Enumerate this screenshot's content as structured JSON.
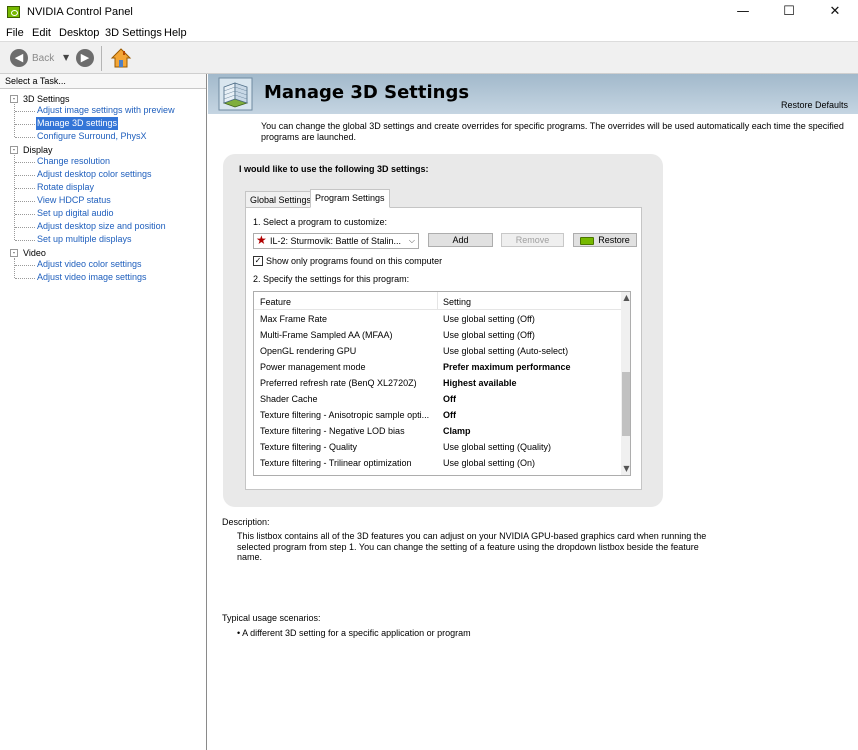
{
  "window": {
    "title": "NVIDIA Control Panel",
    "minimize_glyph": "—",
    "maximize_glyph": "☐",
    "close_glyph": "✕"
  },
  "menu": [
    "File",
    "Edit",
    "Desktop",
    "3D Settings",
    "Help"
  ],
  "toolbar": {
    "back_label": "Back",
    "back_icon": "arrow-left-icon",
    "forward_icon": "arrow-right-icon",
    "home_icon": "home-icon"
  },
  "sidebar": {
    "header": "Select a Task...",
    "groups": [
      {
        "label": "3D Settings",
        "items": [
          {
            "label": "Adjust image settings with preview",
            "selected": false
          },
          {
            "label": "Manage 3D settings",
            "selected": true
          },
          {
            "label": "Configure Surround, PhysX",
            "selected": false
          }
        ]
      },
      {
        "label": "Display",
        "items": [
          {
            "label": "Change resolution",
            "selected": false
          },
          {
            "label": "Adjust desktop color settings",
            "selected": false
          },
          {
            "label": "Rotate display",
            "selected": false
          },
          {
            "label": "View HDCP status",
            "selected": false
          },
          {
            "label": "Set up digital audio",
            "selected": false
          },
          {
            "label": "Adjust desktop size and position",
            "selected": false
          },
          {
            "label": "Set up multiple displays",
            "selected": false
          }
        ]
      },
      {
        "label": "Video",
        "items": [
          {
            "label": "Adjust video color settings",
            "selected": false
          },
          {
            "label": "Adjust video image settings",
            "selected": false
          }
        ]
      }
    ]
  },
  "page": {
    "title": "Manage 3D Settings",
    "restore_defaults": "Restore Defaults",
    "intro": "You can change the global 3D settings and create overrides for specific programs. The overrides will be used automatically each time the specified programs are launched.",
    "panel_heading": "I would like to use the following 3D settings:",
    "tabs": [
      {
        "label": "Global Settings",
        "active": false
      },
      {
        "label": "Program Settings",
        "active": true
      }
    ],
    "step1_label": "1. Select a program to customize:",
    "program_selected": "IL-2: Sturmovik: Battle of Stalin...",
    "buttons": {
      "add": "Add",
      "remove": "Remove",
      "restore": "Restore"
    },
    "show_only_checkbox": {
      "label": "Show only programs found on this computer",
      "checked": true
    },
    "step2_label": "2. Specify the settings for this program:",
    "columns": {
      "feature": "Feature",
      "setting": "Setting"
    },
    "rows": [
      {
        "feature": "Max Frame Rate",
        "setting": "Use global setting (Off)",
        "bold": false
      },
      {
        "feature": "Multi-Frame Sampled AA (MFAA)",
        "setting": "Use global setting (Off)",
        "bold": false
      },
      {
        "feature": "OpenGL rendering GPU",
        "setting": "Use global setting (Auto-select)",
        "bold": false
      },
      {
        "feature": "Power management mode",
        "setting": "Prefer maximum performance",
        "bold": true
      },
      {
        "feature": "Preferred refresh rate (BenQ XL2720Z)",
        "setting": "Highest available",
        "bold": true
      },
      {
        "feature": "Shader Cache",
        "setting": "Off",
        "bold": true
      },
      {
        "feature": "Texture filtering - Anisotropic sample opti...",
        "setting": "Off",
        "bold": true
      },
      {
        "feature": "Texture filtering - Negative LOD bias",
        "setting": "Clamp",
        "bold": true
      },
      {
        "feature": "Texture filtering - Quality",
        "setting": "Use global setting (Quality)",
        "bold": false
      },
      {
        "feature": "Texture filtering - Trilinear optimization",
        "setting": "Use global setting (On)",
        "bold": false
      }
    ],
    "description_label": "Description:",
    "description_text": "This listbox contains all of the 3D features you can adjust on your NVIDIA GPU-based graphics card when running the selected program from step 1. You can change the setting of a feature using the dropdown listbox beside the feature name.",
    "usage_label": "Typical usage scenarios:",
    "usage_items": [
      "A different 3D setting for a specific application or program"
    ]
  }
}
